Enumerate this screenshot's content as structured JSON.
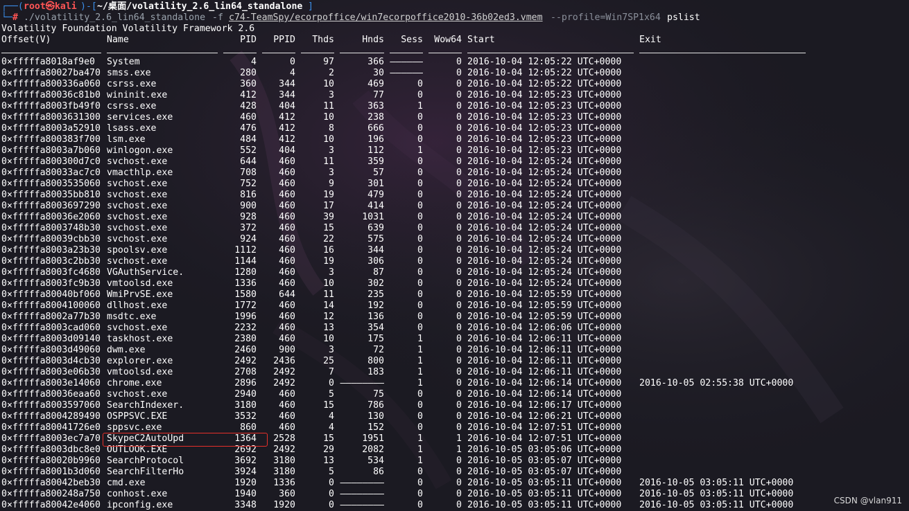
{
  "prompt": {
    "corner": "┌──(",
    "user": "root㉿kali",
    "sep": ")-[",
    "path": "~/桌面/volatility_2.6_lin64_standalone",
    "close": "]",
    "line2_prefix": "└─",
    "hash": "#",
    "cmd": "./volatility_2.6_lin64_standalone",
    "flag_f": "-f",
    "file": "c74-TeamSpy/ecorpoffice/win7ecorpoffice2010-36b02ed3.vmem",
    "profile": "--profile=Win7SP1x64",
    "plugin": "pslist"
  },
  "banner": "Volatility Foundation Volatility Framework 2.6",
  "headers": {
    "offset": "Offset(V)",
    "name": "Name",
    "pid": "PID",
    "ppid": "PPID",
    "thds": "Thds",
    "hnds": "Hnds",
    "sess": "Sess",
    "wow64": "Wow64",
    "start": "Start",
    "exit": "Exit"
  },
  "rows": [
    {
      "offset": "0×fffffa8018af9e0",
      "name": "System",
      "pid": "4",
      "ppid": "0",
      "thds": "97",
      "hnds": "366",
      "sess": "——————",
      "wow64": "0",
      "start": "2016-10-04 12:05:22 UTC+0000",
      "exit": ""
    },
    {
      "offset": "0×fffffa80027ba470",
      "name": "smss.exe",
      "pid": "280",
      "ppid": "4",
      "thds": "2",
      "hnds": "30",
      "sess": "——————",
      "wow64": "0",
      "start": "2016-10-04 12:05:22 UTC+0000",
      "exit": ""
    },
    {
      "offset": "0×fffffa800336a060",
      "name": "csrss.exe",
      "pid": "360",
      "ppid": "344",
      "thds": "10",
      "hnds": "469",
      "sess": "0",
      "wow64": "0",
      "start": "2016-10-04 12:05:22 UTC+0000",
      "exit": ""
    },
    {
      "offset": "0×fffffa80036c81b0",
      "name": "wininit.exe",
      "pid": "412",
      "ppid": "344",
      "thds": "3",
      "hnds": "77",
      "sess": "0",
      "wow64": "0",
      "start": "2016-10-04 12:05:23 UTC+0000",
      "exit": ""
    },
    {
      "offset": "0×fffffa8003fb49f0",
      "name": "csrss.exe",
      "pid": "428",
      "ppid": "404",
      "thds": "11",
      "hnds": "363",
      "sess": "1",
      "wow64": "0",
      "start": "2016-10-04 12:05:23 UTC+0000",
      "exit": ""
    },
    {
      "offset": "0×fffffa8003631300",
      "name": "services.exe",
      "pid": "460",
      "ppid": "412",
      "thds": "10",
      "hnds": "238",
      "sess": "0",
      "wow64": "0",
      "start": "2016-10-04 12:05:23 UTC+0000",
      "exit": ""
    },
    {
      "offset": "0×fffffa8003a52910",
      "name": "lsass.exe",
      "pid": "476",
      "ppid": "412",
      "thds": "8",
      "hnds": "666",
      "sess": "0",
      "wow64": "0",
      "start": "2016-10-04 12:05:23 UTC+0000",
      "exit": ""
    },
    {
      "offset": "0×fffffa800383f700",
      "name": "lsm.exe",
      "pid": "484",
      "ppid": "412",
      "thds": "10",
      "hnds": "196",
      "sess": "0",
      "wow64": "0",
      "start": "2016-10-04 12:05:23 UTC+0000",
      "exit": ""
    },
    {
      "offset": "0×fffffa8003a7b060",
      "name": "winlogon.exe",
      "pid": "552",
      "ppid": "404",
      "thds": "3",
      "hnds": "112",
      "sess": "1",
      "wow64": "0",
      "start": "2016-10-04 12:05:23 UTC+0000",
      "exit": ""
    },
    {
      "offset": "0×fffffa800300d7c0",
      "name": "svchost.exe",
      "pid": "644",
      "ppid": "460",
      "thds": "11",
      "hnds": "359",
      "sess": "0",
      "wow64": "0",
      "start": "2016-10-04 12:05:24 UTC+0000",
      "exit": ""
    },
    {
      "offset": "0×fffffa80033ac7c0",
      "name": "vmacthlp.exe",
      "pid": "708",
      "ppid": "460",
      "thds": "3",
      "hnds": "57",
      "sess": "0",
      "wow64": "0",
      "start": "2016-10-04 12:05:24 UTC+0000",
      "exit": ""
    },
    {
      "offset": "0×fffffa8003535060",
      "name": "svchost.exe",
      "pid": "752",
      "ppid": "460",
      "thds": "9",
      "hnds": "301",
      "sess": "0",
      "wow64": "0",
      "start": "2016-10-04 12:05:24 UTC+0000",
      "exit": ""
    },
    {
      "offset": "0×fffffa80035bb810",
      "name": "svchost.exe",
      "pid": "816",
      "ppid": "460",
      "thds": "19",
      "hnds": "479",
      "sess": "0",
      "wow64": "0",
      "start": "2016-10-04 12:05:24 UTC+0000",
      "exit": ""
    },
    {
      "offset": "0×fffffa8003697290",
      "name": "svchost.exe",
      "pid": "900",
      "ppid": "460",
      "thds": "17",
      "hnds": "414",
      "sess": "0",
      "wow64": "0",
      "start": "2016-10-04 12:05:24 UTC+0000",
      "exit": ""
    },
    {
      "offset": "0×fffffa80036e2060",
      "name": "svchost.exe",
      "pid": "928",
      "ppid": "460",
      "thds": "39",
      "hnds": "1031",
      "sess": "0",
      "wow64": "0",
      "start": "2016-10-04 12:05:24 UTC+0000",
      "exit": ""
    },
    {
      "offset": "0×fffffa8003748b30",
      "name": "svchost.exe",
      "pid": "372",
      "ppid": "460",
      "thds": "15",
      "hnds": "639",
      "sess": "0",
      "wow64": "0",
      "start": "2016-10-04 12:05:24 UTC+0000",
      "exit": ""
    },
    {
      "offset": "0×fffffa80039cbb30",
      "name": "svchost.exe",
      "pid": "924",
      "ppid": "460",
      "thds": "22",
      "hnds": "575",
      "sess": "0",
      "wow64": "0",
      "start": "2016-10-04 12:05:24 UTC+0000",
      "exit": ""
    },
    {
      "offset": "0×fffffa8003a23b30",
      "name": "spoolsv.exe",
      "pid": "1112",
      "ppid": "460",
      "thds": "16",
      "hnds": "344",
      "sess": "0",
      "wow64": "0",
      "start": "2016-10-04 12:05:24 UTC+0000",
      "exit": ""
    },
    {
      "offset": "0×fffffa8003c2bb30",
      "name": "svchost.exe",
      "pid": "1144",
      "ppid": "460",
      "thds": "19",
      "hnds": "306",
      "sess": "0",
      "wow64": "0",
      "start": "2016-10-04 12:05:24 UTC+0000",
      "exit": ""
    },
    {
      "offset": "0×fffffa8003fc4680",
      "name": "VGAuthService.",
      "pid": "1280",
      "ppid": "460",
      "thds": "3",
      "hnds": "87",
      "sess": "0",
      "wow64": "0",
      "start": "2016-10-04 12:05:24 UTC+0000",
      "exit": ""
    },
    {
      "offset": "0×fffffa8003fc9b30",
      "name": "vmtoolsd.exe",
      "pid": "1336",
      "ppid": "460",
      "thds": "10",
      "hnds": "302",
      "sess": "0",
      "wow64": "0",
      "start": "2016-10-04 12:05:24 UTC+0000",
      "exit": ""
    },
    {
      "offset": "0×fffffa80040bf060",
      "name": "WmiPrvSE.exe",
      "pid": "1580",
      "ppid": "644",
      "thds": "11",
      "hnds": "235",
      "sess": "0",
      "wow64": "0",
      "start": "2016-10-04 12:05:59 UTC+0000",
      "exit": ""
    },
    {
      "offset": "0×fffffa8004100060",
      "name": "dllhost.exe",
      "pid": "1772",
      "ppid": "460",
      "thds": "14",
      "hnds": "192",
      "sess": "0",
      "wow64": "0",
      "start": "2016-10-04 12:05:59 UTC+0000",
      "exit": ""
    },
    {
      "offset": "0×fffffa8002a77b30",
      "name": "msdtc.exe",
      "pid": "1996",
      "ppid": "460",
      "thds": "12",
      "hnds": "136",
      "sess": "0",
      "wow64": "0",
      "start": "2016-10-04 12:05:59 UTC+0000",
      "exit": ""
    },
    {
      "offset": "0×fffffa8003cad060",
      "name": "svchost.exe",
      "pid": "2232",
      "ppid": "460",
      "thds": "13",
      "hnds": "354",
      "sess": "0",
      "wow64": "0",
      "start": "2016-10-04 12:06:06 UTC+0000",
      "exit": ""
    },
    {
      "offset": "0×fffffa8003d09140",
      "name": "taskhost.exe",
      "pid": "2380",
      "ppid": "460",
      "thds": "10",
      "hnds": "175",
      "sess": "1",
      "wow64": "0",
      "start": "2016-10-04 12:06:11 UTC+0000",
      "exit": ""
    },
    {
      "offset": "0×fffffa8003d49060",
      "name": "dwm.exe",
      "pid": "2460",
      "ppid": "900",
      "thds": "3",
      "hnds": "72",
      "sess": "1",
      "wow64": "0",
      "start": "2016-10-04 12:06:11 UTC+0000",
      "exit": ""
    },
    {
      "offset": "0×fffffa8003d4cb30",
      "name": "explorer.exe",
      "pid": "2492",
      "ppid": "2436",
      "thds": "25",
      "hnds": "800",
      "sess": "1",
      "wow64": "0",
      "start": "2016-10-04 12:06:11 UTC+0000",
      "exit": ""
    },
    {
      "offset": "0×fffffa8003e06b30",
      "name": "vmtoolsd.exe",
      "pid": "2708",
      "ppid": "2492",
      "thds": "7",
      "hnds": "183",
      "sess": "1",
      "wow64": "0",
      "start": "2016-10-04 12:06:11 UTC+0000",
      "exit": ""
    },
    {
      "offset": "0×fffffa8003e14060",
      "name": "chrome.exe",
      "pid": "2896",
      "ppid": "2492",
      "thds": "0",
      "hnds": "————————",
      "sess": "1",
      "wow64": "0",
      "start": "2016-10-04 12:06:14 UTC+0000",
      "exit": "2016-10-05 02:55:38 UTC+0000"
    },
    {
      "offset": "0×fffffa80036eaa60",
      "name": "svchost.exe",
      "pid": "2940",
      "ppid": "460",
      "thds": "5",
      "hnds": "75",
      "sess": "0",
      "wow64": "0",
      "start": "2016-10-04 12:06:14 UTC+0000",
      "exit": ""
    },
    {
      "offset": "0×fffffa8003597060",
      "name": "SearchIndexer.",
      "pid": "3180",
      "ppid": "460",
      "thds": "15",
      "hnds": "786",
      "sess": "0",
      "wow64": "0",
      "start": "2016-10-04 12:06:17 UTC+0000",
      "exit": ""
    },
    {
      "offset": "0×fffffa8004289490",
      "name": "OSPPSVC.EXE",
      "pid": "3532",
      "ppid": "460",
      "thds": "4",
      "hnds": "130",
      "sess": "0",
      "wow64": "0",
      "start": "2016-10-04 12:06:21 UTC+0000",
      "exit": ""
    },
    {
      "offset": "0×fffffa80041726e0",
      "name": "sppsvc.exe",
      "pid": "860",
      "ppid": "460",
      "thds": "4",
      "hnds": "152",
      "sess": "0",
      "wow64": "0",
      "start": "2016-10-04 12:07:51 UTC+0000",
      "exit": ""
    },
    {
      "offset": "0×fffffa8003ec7a70",
      "name": "SkypeC2AutoUpd",
      "pid": "1364",
      "ppid": "2528",
      "thds": "15",
      "hnds": "1951",
      "sess": "1",
      "wow64": "1",
      "start": "2016-10-04 12:07:51 UTC+0000",
      "exit": ""
    },
    {
      "offset": "0×fffffa8003dbc8e0",
      "name": "OUTLOOK.EXE",
      "pid": "2692",
      "ppid": "2492",
      "thds": "29",
      "hnds": "2082",
      "sess": "1",
      "wow64": "1",
      "start": "2016-10-05 03:05:06 UTC+0000",
      "exit": ""
    },
    {
      "offset": "0×fffffa80020b9960",
      "name": "SearchProtocol",
      "pid": "3692",
      "ppid": "3180",
      "thds": "13",
      "hnds": "534",
      "sess": "1",
      "wow64": "0",
      "start": "2016-10-05 03:05:07 UTC+0000",
      "exit": ""
    },
    {
      "offset": "0×fffffa8001b3d060",
      "name": "SearchFilterHo",
      "pid": "3924",
      "ppid": "3180",
      "thds": "5",
      "hnds": "86",
      "sess": "0",
      "wow64": "0",
      "start": "2016-10-05 03:05:07 UTC+0000",
      "exit": ""
    },
    {
      "offset": "0×fffffa80042beb30",
      "name": "cmd.exe",
      "pid": "1920",
      "ppid": "1336",
      "thds": "0",
      "hnds": "————————",
      "sess": "0",
      "wow64": "0",
      "start": "2016-10-05 03:05:11 UTC+0000",
      "exit": "2016-10-05 03:05:11 UTC+0000"
    },
    {
      "offset": "0×fffffa800248a750",
      "name": "conhost.exe",
      "pid": "1940",
      "ppid": "360",
      "thds": "0",
      "hnds": "————————",
      "sess": "0",
      "wow64": "0",
      "start": "2016-10-05 03:05:11 UTC+0000",
      "exit": "2016-10-05 03:05:11 UTC+0000"
    },
    {
      "offset": "0×fffffa80042e4060",
      "name": "ipconfig.exe",
      "pid": "3348",
      "ppid": "1920",
      "thds": "0",
      "hnds": "————————",
      "sess": "0",
      "wow64": "0",
      "start": "2016-10-05 03:05:11 UTC+0000",
      "exit": "2016-10-05 03:05:11 UTC+0000"
    }
  ],
  "watermark": "CSDN @vlan911",
  "colors": {
    "background": "#1b1a22",
    "text": "#ffffff",
    "prompt_accent": "#3b8eea",
    "user_red": "#ff5555",
    "highlight_box": "#e8302a"
  }
}
